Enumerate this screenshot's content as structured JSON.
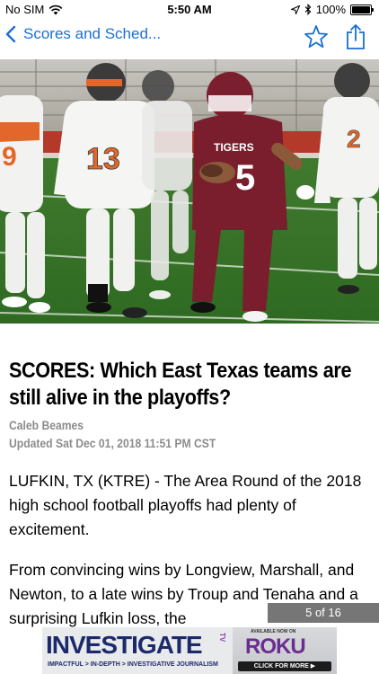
{
  "status_bar": {
    "carrier": "No SIM",
    "time": "5:50 AM",
    "battery": "100%"
  },
  "nav": {
    "back_label": "Scores and Sched..."
  },
  "hero": {
    "jersey_front": "5",
    "jersey_front_team": "TIGERS",
    "jersey_left": "13",
    "jersey_far_left": "9",
    "jersey_right": "2"
  },
  "article": {
    "headline": "SCORES: Which East Texas teams are still alive in the playoffs?",
    "author": "Caleb Beames",
    "updated": "Updated Sat Dec 01, 2018 11:51 PM CST",
    "paragraph_1": "LUFKIN, TX (KTRE) - The Area Round of the 2018 high school football playoffs had plenty of excitement.",
    "paragraph_2": "From convincing wins by Longview, Marshall, and Newton, to a late wins by Troup and Tenaha and a surprising Lufkin loss, the"
  },
  "counter": "5 of 16",
  "ad": {
    "title": "INVESTIGATE",
    "tv": "TV",
    "subtitle": "IMPACTFUL > IN-DEPTH > INVESTIGATIVE JOURNALISM",
    "available": "AVAILABLE NOW ON",
    "brand": "ROKU",
    "cta": "CLICK FOR MORE ▶"
  },
  "colors": {
    "accent": "#1a6fd4",
    "byline_gray": "#8c8c8c",
    "ad_navy": "#1c2a6b",
    "ad_purple": "#6b2d91"
  }
}
